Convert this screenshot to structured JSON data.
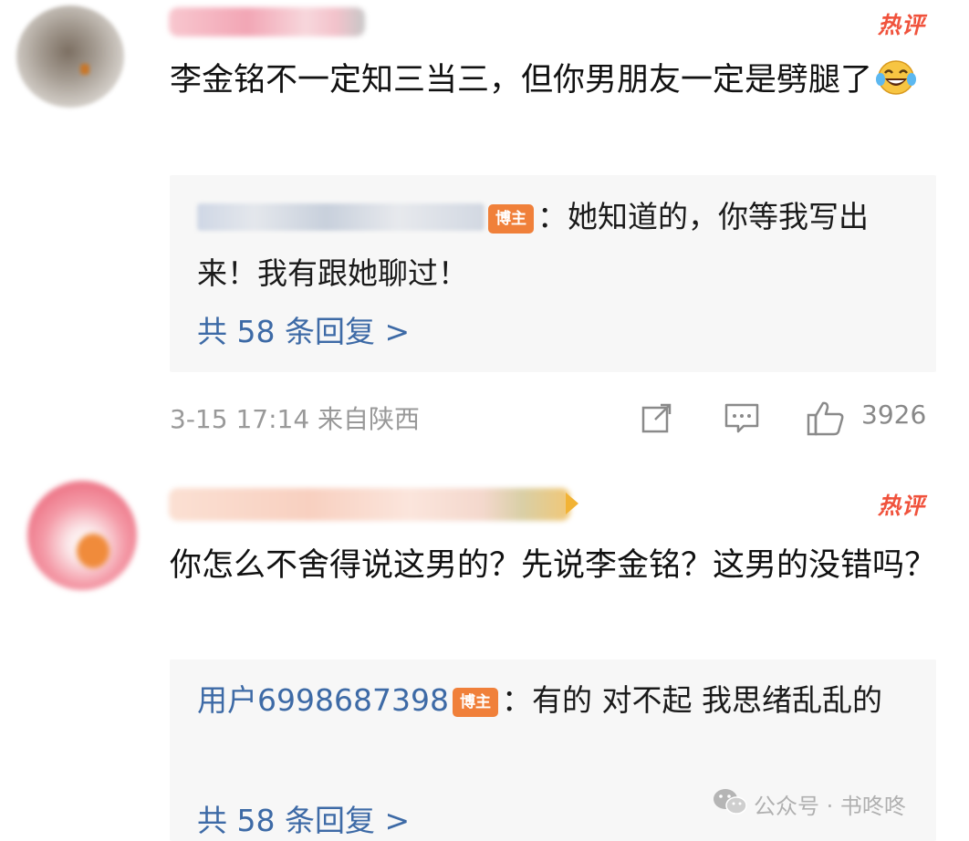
{
  "comments": [
    {
      "hot_badge": "热评",
      "text": "李金铭不一定知三当三，但你男朋友一定是劈腿了",
      "reply": {
        "name": "",
        "author_badge": "博主",
        "text": "：她知道的，你等我写出来！我有跟她聊过！",
        "more": "共 58 条回复 >"
      },
      "meta": "3-15 17:14 来自陕西",
      "likes": "3926",
      "icons": [
        "share-icon",
        "comment-icon",
        "like-icon"
      ]
    },
    {
      "hot_badge": "热评",
      "text": "你怎么不舍得说这男的？先说李金铭？这男的没错吗？",
      "reply": {
        "name": "用户6998687398",
        "author_badge": "博主",
        "text": "：有的 对不起 我思绪乱乱的",
        "more": "共 58 条回复 >"
      }
    }
  ],
  "watermark": "公众号 · 书咚咚",
  "colors": {
    "hot": "#f0523c",
    "link": "#3d6aa6",
    "author_badge": "#f0803a",
    "reply_bg": "#f7f7f7"
  }
}
